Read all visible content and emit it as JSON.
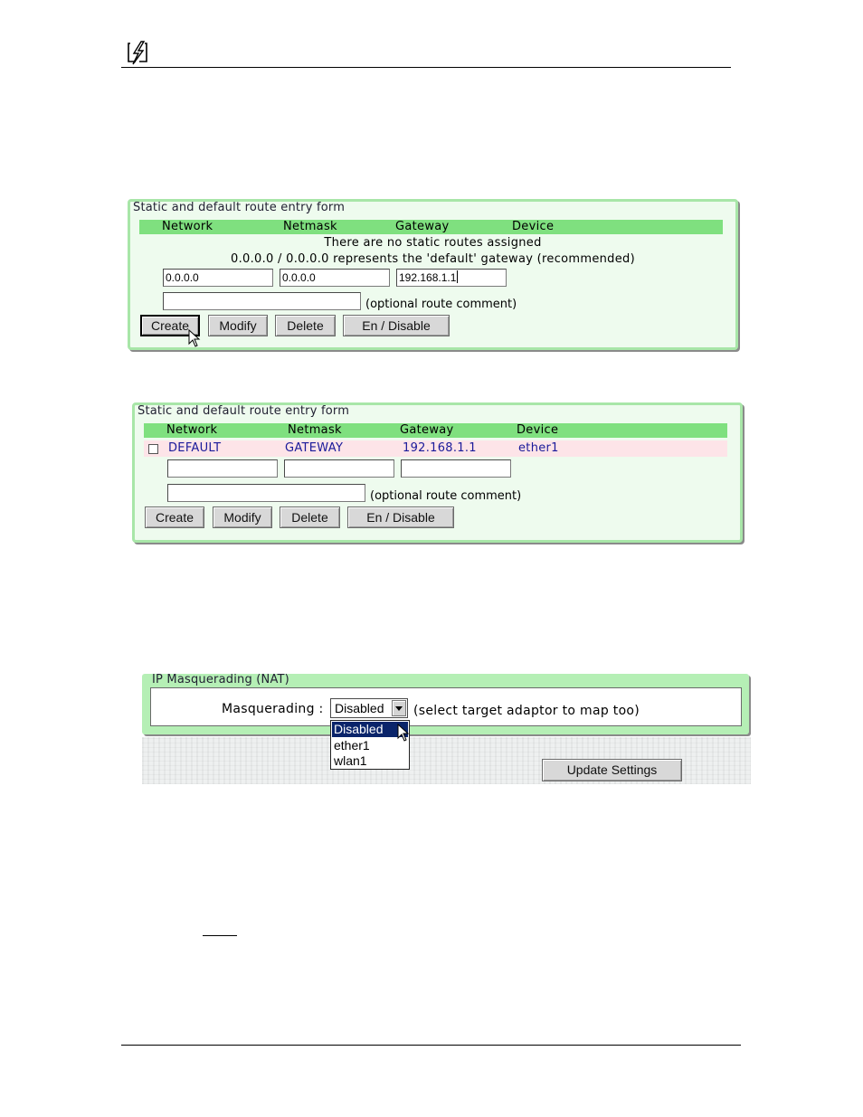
{
  "route_form_1": {
    "title": "Static and default route entry form",
    "headers": [
      "Network",
      "Netmask",
      "Gateway",
      "Device"
    ],
    "no_routes_msg": "There are no static routes assigned",
    "default_msg": "0.0.0.0 / 0.0.0.0 represents the 'default' gateway (recommended)",
    "network_value": "0.0.0.0",
    "netmask_value": "0.0.0.0",
    "gateway_value": "192.168.1.1",
    "comment_label": "(optional route comment)",
    "buttons": {
      "create": "Create",
      "modify": "Modify",
      "delete": "Delete",
      "toggle": "En / Disable"
    }
  },
  "route_form_2": {
    "title": "Static and default route entry form",
    "headers": [
      "Network",
      "Netmask",
      "Gateway",
      "Device"
    ],
    "route": {
      "network": "DEFAULT",
      "netmask": "GATEWAY",
      "gateway": "192.168.1.1",
      "device": "ether1"
    },
    "comment_label": "(optional route comment)",
    "buttons": {
      "create": "Create",
      "modify": "Modify",
      "delete": "Delete",
      "toggle": "En / Disable"
    }
  },
  "nat": {
    "title": "IP Masquerading (NAT)",
    "label": "Masquerading :",
    "selected": "Disabled",
    "hint": "(select target adaptor to map too)",
    "options": [
      "Disabled",
      "ether1",
      "wlan1"
    ],
    "update_button": "Update Settings"
  },
  "colors": {
    "panel_border": "#a8e6a8",
    "header_green": "#7fe07f",
    "route_row_pink": "#fde4e8",
    "selection_blue": "#0a246a"
  }
}
